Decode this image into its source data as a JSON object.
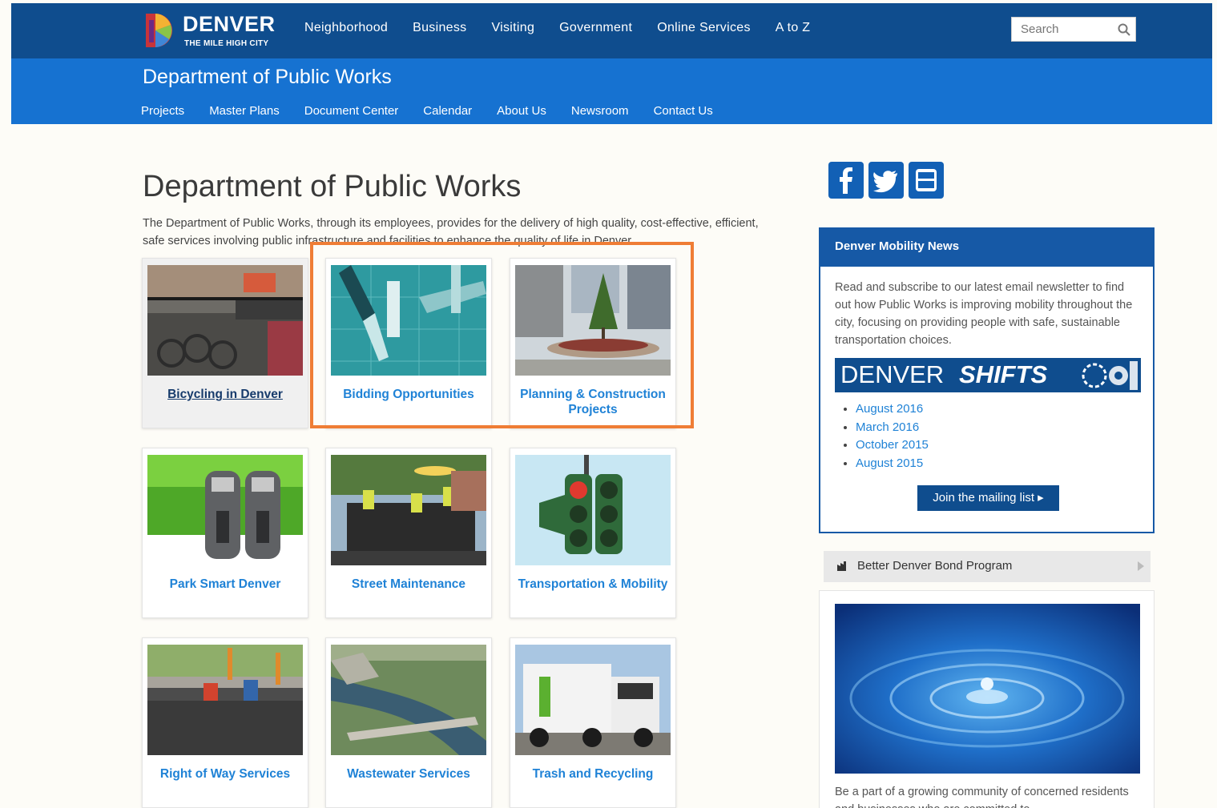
{
  "header": {
    "logo": {
      "word": "DENVER",
      "tagline": "THE MILE HIGH CITY"
    },
    "nav": [
      "Neighborhood",
      "Business",
      "Visiting",
      "Government",
      "Online Services",
      "A to Z"
    ],
    "search_placeholder": "Search"
  },
  "dept": {
    "title": "Department of Public Works",
    "subnav": [
      "Projects",
      "Master Plans",
      "Document Center",
      "Calendar",
      "About Us",
      "Newsroom",
      "Contact Us"
    ]
  },
  "main": {
    "title": "Department of Public Works",
    "intro": "The Department of Public Works, through its employees, provides for the delivery of high quality, cost-effective, efficient, safe services involving public infrastructure and facilities to enhance the quality of life in Denver.",
    "tiles": [
      {
        "label": "Bicycling in Denver"
      },
      {
        "label": "Bidding Opportunities"
      },
      {
        "label": "Planning & Construction Projects"
      },
      {
        "label": "Park Smart Denver"
      },
      {
        "label": "Street Maintenance"
      },
      {
        "label": "Transportation & Mobility"
      },
      {
        "label": "Right of Way Services"
      },
      {
        "label": "Wastewater Services"
      },
      {
        "label": "Trash and Recycling"
      }
    ]
  },
  "sidebar": {
    "social": [
      "facebook-icon",
      "twitter-icon",
      "youtube-icon"
    ],
    "news": {
      "heading": "Denver Mobility News",
      "body": "Read and subscribe to our latest email newsletter to find out how Public Works is improving mobility throughout the city, focusing on providing people with safe, sustainable transportation choices.",
      "banner_a": "DENVER",
      "banner_b": "SHIFTS",
      "links": [
        "August 2016",
        "March 2016",
        "October 2015",
        "August 2015"
      ],
      "join": "Join the mailing list ▸"
    },
    "bond": {
      "label": "Better Denver Bond Program"
    },
    "water_text": "Be a part of a growing community of concerned residents and businesses who are committed to"
  },
  "colors": {
    "nav_dark": "#0f4d8e",
    "nav_light": "#1672d1",
    "link": "#1f82d6",
    "highlight": "#ef7d35"
  }
}
